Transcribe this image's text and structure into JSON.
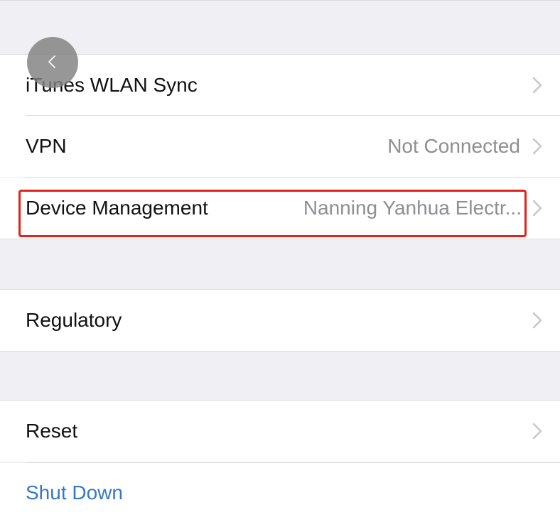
{
  "settings": {
    "rows": [
      {
        "label": "iTunes WLAN Sync",
        "value": ""
      },
      {
        "label": "VPN",
        "value": "Not Connected"
      },
      {
        "label": "Device Management",
        "value": "Nanning Yanhua Electr..."
      },
      {
        "label": "Regulatory",
        "value": ""
      },
      {
        "label": "Reset",
        "value": ""
      },
      {
        "label": "Shut Down",
        "value": ""
      }
    ]
  },
  "icons": {
    "chevron": "chevron-right-icon",
    "back": "back-arrow-icon"
  },
  "colors": {
    "background": "#efeff4",
    "row": "#ffffff",
    "label": "#111111",
    "value": "#8e8e93",
    "link": "#3478c8",
    "highlight": "#e2231a"
  }
}
